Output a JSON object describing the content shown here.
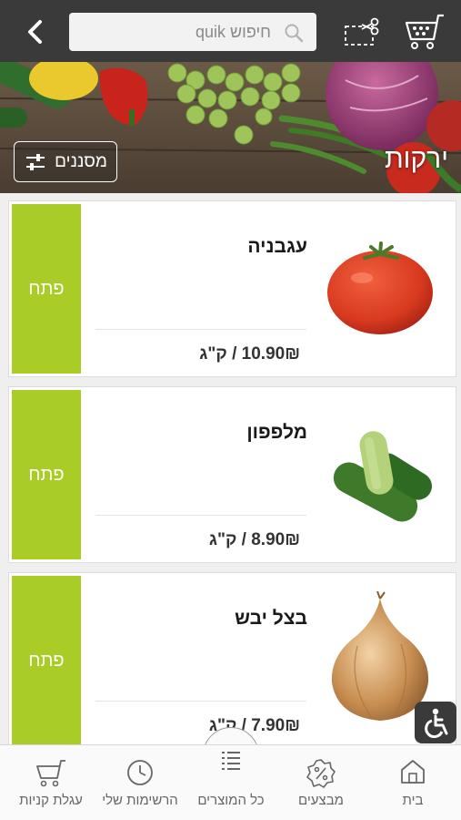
{
  "header": {
    "search_placeholder": "חיפוש quik",
    "back_icon": "chevron-left-icon",
    "scissors_icon": "scissors-icon",
    "cart_icon": "shopping-cart-icon"
  },
  "banner": {
    "category_title": "ירקות",
    "filter_label": "מסננים",
    "filter_icon": "sliders-icon"
  },
  "products": [
    {
      "name": "עגבניה",
      "price": "10.90₪ / ק\"ג",
      "open_label": "פתח",
      "image": "tomato"
    },
    {
      "name": "מלפפון",
      "price": "8.90₪ / ק\"ג",
      "open_label": "פתח",
      "image": "cucumber"
    },
    {
      "name": "בצל יבש",
      "price": "7.90₪ / ק\"ג",
      "open_label": "פתח",
      "image": "onion"
    }
  ],
  "bottom_nav": {
    "cart": "עגלת קניות",
    "my_lists": "הרשימות שלי",
    "all_products": "כל המוצרים",
    "deals": "מבצעים",
    "home": "בית"
  },
  "colors": {
    "header_bg": "#3a3a3a",
    "open_button": "#a9cc27",
    "nav_bg": "#fafafa"
  }
}
